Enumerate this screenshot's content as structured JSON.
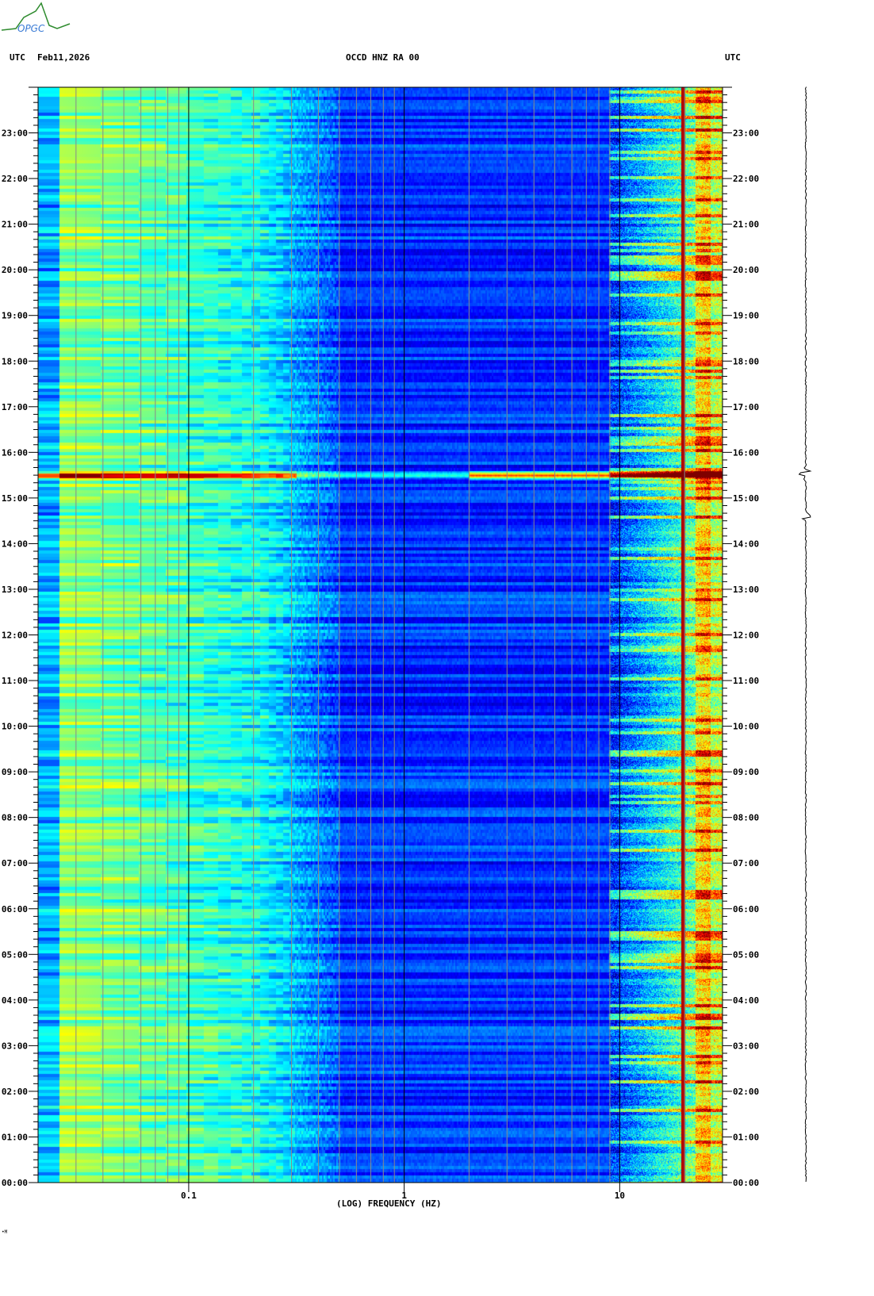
{
  "header": {
    "left_tz": "UTC",
    "date": "Feb11,2026",
    "station": "OCCD HNZ RA 00",
    "right_tz": "UTC"
  },
  "logo": {
    "text": "OPGC"
  },
  "footer_mark": "•M",
  "colors": {
    "background_low": "#0a14a8",
    "grid_minor": "#8a8a8a",
    "grid_major": "#000000",
    "logo_green": "#2e8b2e",
    "logo_blue": "#3a7bd5"
  },
  "chart_data": {
    "type": "heatmap",
    "title": "OCCD HNZ RA 00",
    "xlabel": "(LOG) FREQUENCY (HZ)",
    "ylabel": "UTC",
    "x_scale": "log",
    "xlim": [
      0.02,
      30
    ],
    "ylim_hours": [
      0,
      24
    ],
    "x_tick_labels": [
      "0.1",
      "1",
      "10"
    ],
    "x_tick_values": [
      0.1,
      1,
      10
    ],
    "y_tick_labels": [
      "00:00",
      "01:00",
      "02:00",
      "03:00",
      "04:00",
      "05:00",
      "06:00",
      "07:00",
      "08:00",
      "09:00",
      "10:00",
      "11:00",
      "12:00",
      "13:00",
      "14:00",
      "15:00",
      "16:00",
      "17:00",
      "18:00",
      "19:00",
      "20:00",
      "21:00",
      "22:00",
      "23:00"
    ],
    "y_minor_tick_minutes": 10,
    "colormap": "jet",
    "features": {
      "persistent_line_hz": 19.7,
      "event_time_hours": 15.5,
      "event_description_visible": false
    }
  }
}
